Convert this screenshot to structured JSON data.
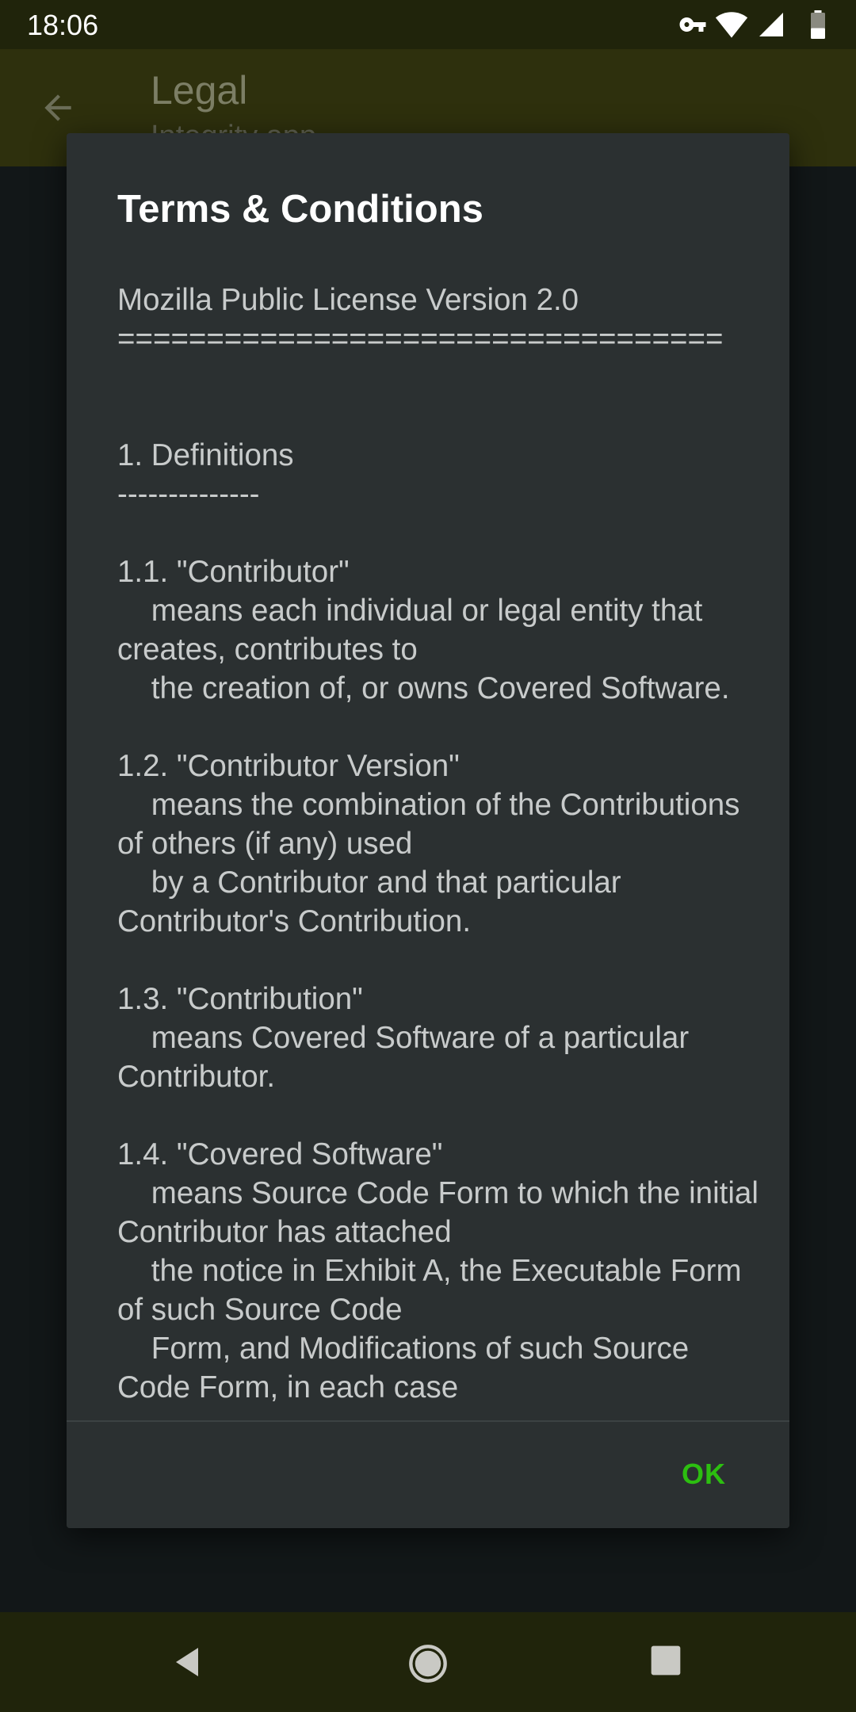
{
  "status_bar": {
    "time": "18:06",
    "icons": [
      "vpn-key-icon",
      "wifi-icon",
      "cell-signal-icon",
      "battery-icon"
    ]
  },
  "app_bar": {
    "title": "Legal",
    "subtitle": "Integrity app"
  },
  "dialog": {
    "title": "Terms & Conditions",
    "body": "Mozilla Public License Version 2.0\n==================================\n\n\n1. Definitions\n--------------\n\n1.1. \"Contributor\"\n    means each individual or legal entity that creates, contributes to\n    the creation of, or owns Covered Software.\n\n1.2. \"Contributor Version\"\n    means the combination of the Contributions of others (if any) used\n    by a Contributor and that particular Contributor's Contribution.\n\n1.3. \"Contribution\"\n    means Covered Software of a particular Contributor.\n\n1.4. \"Covered Software\"\n    means Source Code Form to which the initial Contributor has attached\n    the notice in Exhibit A, the Executable Form of such Source Code\n    Form, and Modifications of such Source Code Form, in each case",
    "ok_label": "OK"
  },
  "colors": {
    "accent": "#2cbf10",
    "status_bar": "#20240b",
    "app_bar": "#2e300d",
    "dialog_bg": "#2b3031"
  },
  "nav_bar": {
    "icons": [
      "back-triangle-icon",
      "home-circle-icon",
      "recents-square-icon"
    ]
  }
}
